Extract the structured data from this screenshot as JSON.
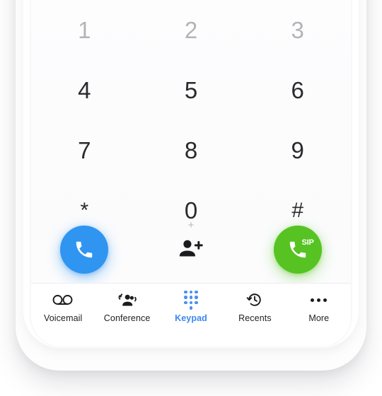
{
  "app": {
    "screen_name": "Keypad",
    "background_color": "#ffffff",
    "screen_background": "#fcfcfd"
  },
  "keypad": {
    "keys": [
      {
        "digit": "1",
        "sub": "",
        "dim": true
      },
      {
        "digit": "2",
        "sub": "",
        "dim": true
      },
      {
        "digit": "3",
        "sub": "",
        "dim": true
      },
      {
        "digit": "4",
        "sub": "",
        "dim": false
      },
      {
        "digit": "5",
        "sub": "",
        "dim": false
      },
      {
        "digit": "6",
        "sub": "",
        "dim": false
      },
      {
        "digit": "7",
        "sub": "",
        "dim": false
      },
      {
        "digit": "8",
        "sub": "",
        "dim": false
      },
      {
        "digit": "9",
        "sub": "",
        "dim": false
      },
      {
        "digit": "*",
        "sub": "",
        "dim": false
      },
      {
        "digit": "0",
        "sub": "+",
        "dim": false
      },
      {
        "digit": "#",
        "sub": "",
        "dim": false
      }
    ]
  },
  "actions": {
    "call": {
      "icon": "phone-handset-icon",
      "color": "#2f95f0",
      "aria_label": "Call"
    },
    "add_contact": {
      "icon": "person-add-icon",
      "color": "#1c1c1e",
      "aria_label": "Add contact"
    },
    "sip_call": {
      "icon": "phone-handset-icon",
      "badge": "SIP",
      "color": "#56c322",
      "aria_label": "SIP call"
    }
  },
  "tabbar": {
    "active_color": "#3b89f0",
    "inactive_color": "#1f1f22",
    "tabs": [
      {
        "label": "Voicemail",
        "icon": "voicemail-icon",
        "active": false
      },
      {
        "label": "Conference",
        "icon": "conference-icon",
        "active": false
      },
      {
        "label": "Keypad",
        "icon": "keypad-icon",
        "active": true
      },
      {
        "label": "Recents",
        "icon": "history-icon",
        "active": false
      },
      {
        "label": "More",
        "icon": "more-icon",
        "active": false
      }
    ]
  }
}
